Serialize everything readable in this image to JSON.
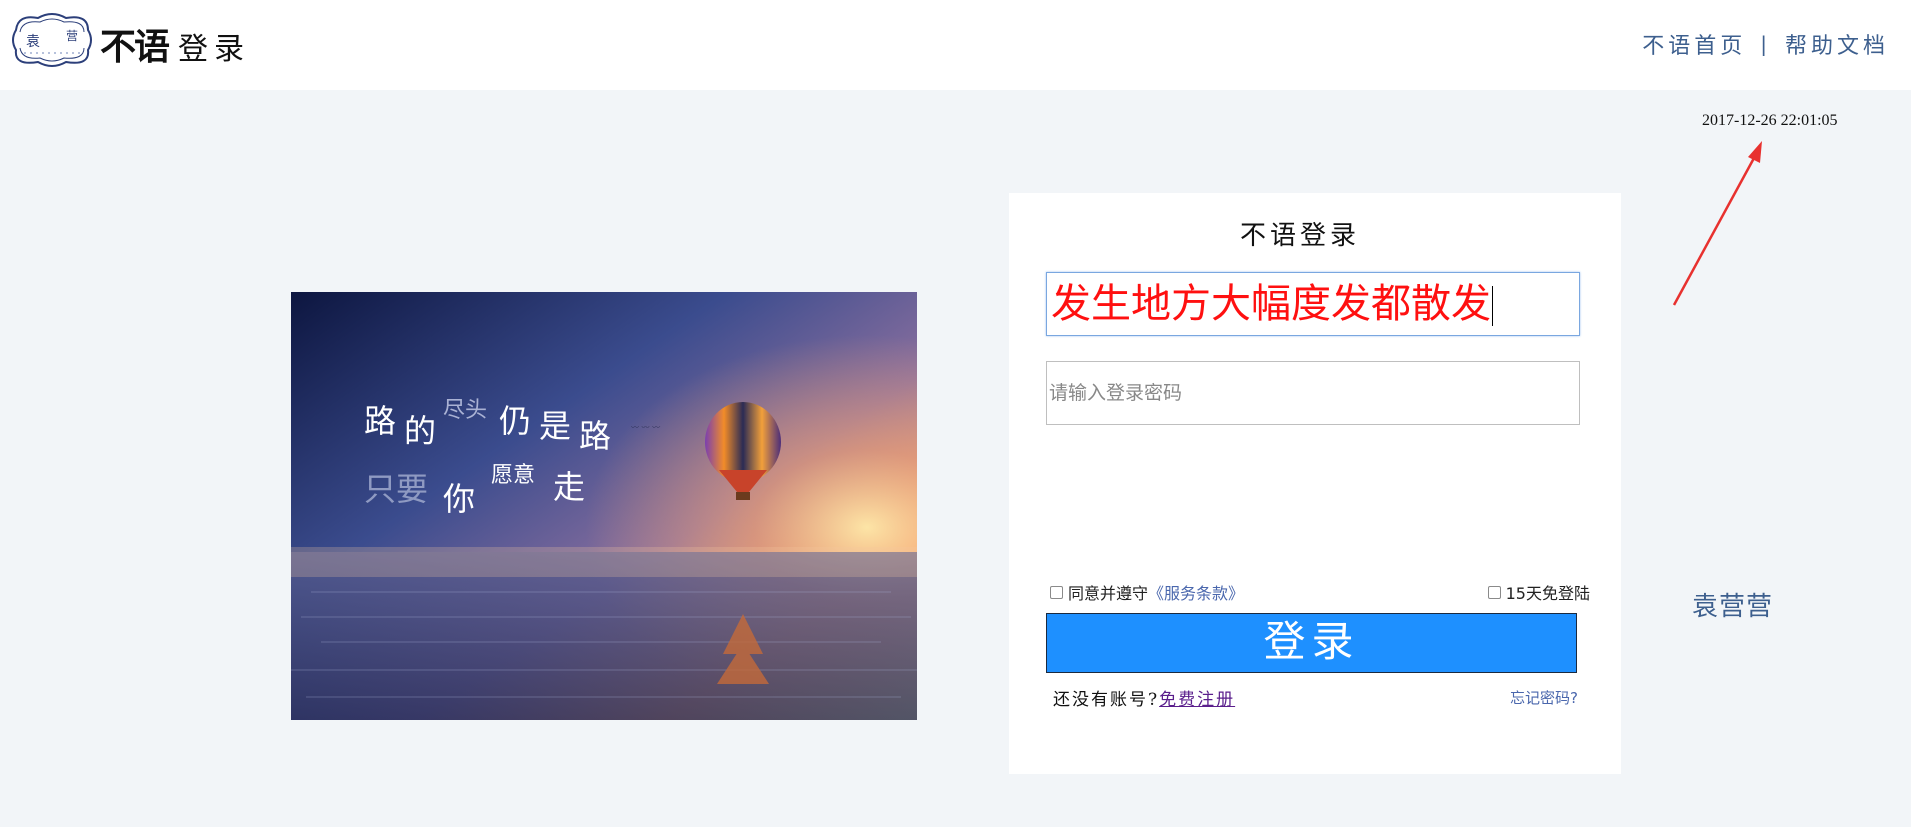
{
  "header": {
    "logo_brand": "不语",
    "logo_sub": "登录",
    "badge_text": [
      "袁",
      "营"
    ],
    "nav": [
      {
        "label": "不语首页"
      },
      {
        "label": "帮助文档"
      }
    ],
    "nav_separator": "|"
  },
  "datetime": "2017-12-26 22:01:05",
  "hero": {
    "line1": [
      "路",
      "的",
      "尽头",
      "仍",
      "是",
      "路"
    ],
    "line2": [
      "只要",
      "你",
      "愿意",
      "走"
    ]
  },
  "login": {
    "title": "不语登录",
    "username_value": "发生地方大幅度发都散发",
    "password_placeholder": "请输入登录密码",
    "agree_label": "同意并遵守",
    "terms_label": "《服务条款》",
    "remember_label": "15天免登陆",
    "submit_label": "登录",
    "no_account_label": "还没有账号?",
    "register_label": "免费注册",
    "forgot_label": "忘记密码?"
  },
  "side_name": "袁营营",
  "colors": {
    "accent": "#1e90ff",
    "nav_text": "#3d5f8e",
    "link": "#4a67ad",
    "username_text": "#ff1010",
    "page_bg": "#f2f5f8",
    "arrow": "#e8312f"
  }
}
